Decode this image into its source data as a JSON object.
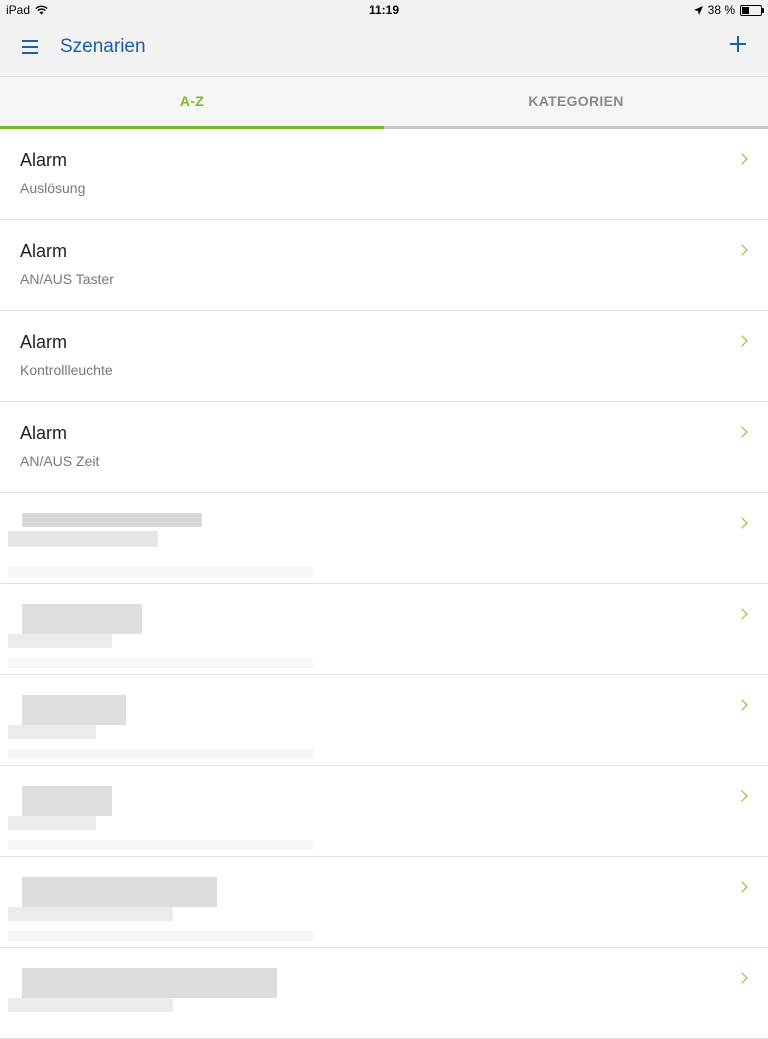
{
  "status_bar": {
    "device": "iPad",
    "time": "11:19",
    "battery": "38 %",
    "battery_level": 0.38
  },
  "header": {
    "title": "Szenarien"
  },
  "tabs": [
    {
      "label": "A-Z",
      "active": true
    },
    {
      "label": "KATEGORIEN",
      "active": false
    }
  ],
  "list": {
    "items": [
      {
        "title": "Alarm",
        "subtitle": "Auslösung"
      },
      {
        "title": "Alarm",
        "subtitle": "AN/AUS Taster"
      },
      {
        "title": "Alarm",
        "subtitle": "Kontrollleuchte"
      },
      {
        "title": "Alarm",
        "subtitle": "AN/AUS Zeit"
      }
    ],
    "redacted_rows": 6
  },
  "colors": {
    "accent_blue": "#1a5fa8",
    "accent_green": "#7ab829"
  }
}
